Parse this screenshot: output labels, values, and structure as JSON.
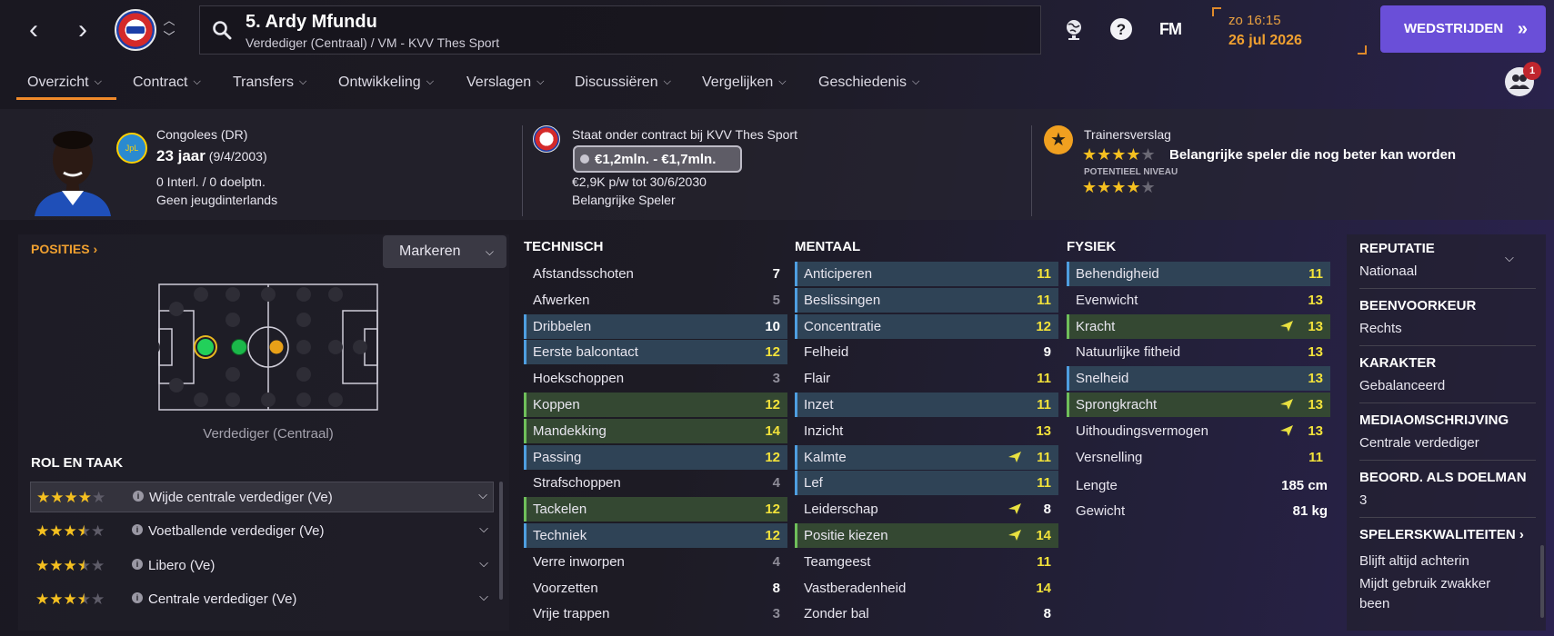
{
  "header": {
    "player_name": "5. Ardy Mfundu",
    "player_subtitle": "Verdediger (Centraal) / VM - KVV Thes Sport",
    "fm_logo": "FM",
    "date_time": "zo 16:15",
    "date": "26 jul 2026",
    "continue_button": "WEDSTRIJDEN",
    "icons": [
      "back-icon",
      "forward-icon",
      "club-logo",
      "up-down-icon",
      "search-icon",
      "globe-icon",
      "help-icon",
      "fm-logo"
    ]
  },
  "tabs": [
    "Overzicht",
    "Contract",
    "Transfers",
    "Ontwikkeling",
    "Verslagen",
    "Discussiëren",
    "Vergelijken",
    "Geschiedenis"
  ],
  "social_badge": "1",
  "profile": {
    "nationality": "Congolees (DR)",
    "flag_text": "JpL",
    "age": "23 jaar",
    "dob": "(9/4/2003)",
    "caps": "0 Interl. / 0 doelptn.",
    "youth": "Geen jeugdinterlands"
  },
  "contract": {
    "status": "Staat onder contract bij KVV Thes Sport",
    "value": "€1,2mln. - €1,7mln.",
    "wage": "€2,9K p/w tot 30/6/2030",
    "role": "Belangrijke Speler"
  },
  "report": {
    "title": "Trainersverslag",
    "ability_stars": 4,
    "ability_text": "Belangrijke speler die nog beter kan worden",
    "potential_label": "POTENTIEEL NIVEAU",
    "potential_stars": 4
  },
  "positions": {
    "title": "POSITIES",
    "mark_button": "Markeren",
    "position_label": "Verdediger (Centraal)",
    "role_title": "ROL EN TAAK",
    "roles": [
      {
        "stars": 4,
        "label": "Wijde centrale verdediger (Ve)"
      },
      {
        "stars": 3.5,
        "label": "Voetballende verdediger (Ve)"
      },
      {
        "stars": 3.5,
        "label": "Libero (Ve)"
      },
      {
        "stars": 3.5,
        "label": "Centrale verdediger (Ve)"
      }
    ]
  },
  "attributes": {
    "technical_title": "TECHNISCH",
    "mental_title": "MENTAAL",
    "physical_title": "FYSIEK",
    "technical": [
      {
        "name": "Afstandsschoten",
        "value": "7",
        "hl": "",
        "tone": "white"
      },
      {
        "name": "Afwerken",
        "value": "5",
        "hl": "",
        "tone": "grey"
      },
      {
        "name": "Dribbelen",
        "value": "10",
        "hl": "blue",
        "tone": "white"
      },
      {
        "name": "Eerste balcontact",
        "value": "12",
        "hl": "blue",
        "tone": "yellow"
      },
      {
        "name": "Hoekschoppen",
        "value": "3",
        "hl": "",
        "tone": "grey"
      },
      {
        "name": "Koppen",
        "value": "12",
        "hl": "green",
        "tone": "yellow"
      },
      {
        "name": "Mandekking",
        "value": "14",
        "hl": "green",
        "tone": "yellow"
      },
      {
        "name": "Passing",
        "value": "12",
        "hl": "blue",
        "tone": "yellow"
      },
      {
        "name": "Strafschoppen",
        "value": "4",
        "hl": "",
        "tone": "grey"
      },
      {
        "name": "Tackelen",
        "value": "12",
        "hl": "green",
        "tone": "yellow"
      },
      {
        "name": "Techniek",
        "value": "12",
        "hl": "blue",
        "tone": "yellow"
      },
      {
        "name": "Verre inworpen",
        "value": "4",
        "hl": "",
        "tone": "grey"
      },
      {
        "name": "Voorzetten",
        "value": "8",
        "hl": "",
        "tone": "white"
      },
      {
        "name": "Vrije trappen",
        "value": "3",
        "hl": "",
        "tone": "grey"
      }
    ],
    "mental": [
      {
        "name": "Anticiperen",
        "value": "11",
        "hl": "blue",
        "tone": "yellow"
      },
      {
        "name": "Beslissingen",
        "value": "11",
        "hl": "blue",
        "tone": "yellow"
      },
      {
        "name": "Concentratie",
        "value": "12",
        "hl": "blue",
        "tone": "yellow"
      },
      {
        "name": "Felheid",
        "value": "9",
        "hl": "",
        "tone": "white"
      },
      {
        "name": "Flair",
        "value": "11",
        "hl": "",
        "tone": "yellow"
      },
      {
        "name": "Inzet",
        "value": "11",
        "hl": "blue",
        "tone": "yellow"
      },
      {
        "name": "Inzicht",
        "value": "13",
        "hl": "",
        "tone": "yellow"
      },
      {
        "name": "Kalmte",
        "value": "11",
        "hl": "blue",
        "tone": "yellow",
        "trend": true
      },
      {
        "name": "Lef",
        "value": "11",
        "hl": "blue",
        "tone": "yellow"
      },
      {
        "name": "Leiderschap",
        "value": "8",
        "hl": "",
        "tone": "white",
        "trend": true
      },
      {
        "name": "Positie kiezen",
        "value": "14",
        "hl": "green",
        "tone": "yellow",
        "trend": true
      },
      {
        "name": "Teamgeest",
        "value": "11",
        "hl": "",
        "tone": "yellow"
      },
      {
        "name": "Vastberadenheid",
        "value": "14",
        "hl": "",
        "tone": "yellow"
      },
      {
        "name": "Zonder bal",
        "value": "8",
        "hl": "",
        "tone": "white"
      }
    ],
    "physical": [
      {
        "name": "Behendigheid",
        "value": "11",
        "hl": "blue",
        "tone": "yellow"
      },
      {
        "name": "Evenwicht",
        "value": "13",
        "hl": "",
        "tone": "yellow"
      },
      {
        "name": "Kracht",
        "value": "13",
        "hl": "green",
        "tone": "yellow",
        "trend": true
      },
      {
        "name": "Natuurlijke fitheid",
        "value": "13",
        "hl": "",
        "tone": "yellow"
      },
      {
        "name": "Snelheid",
        "value": "13",
        "hl": "blue",
        "tone": "yellow"
      },
      {
        "name": "Sprongkracht",
        "value": "13",
        "hl": "green",
        "tone": "yellow",
        "trend": true
      },
      {
        "name": "Uithoudingsvermogen",
        "value": "13",
        "hl": "",
        "tone": "yellow",
        "trend": true
      },
      {
        "name": "Versnelling",
        "value": "11",
        "hl": "",
        "tone": "yellow"
      }
    ],
    "height_label": "Lengte",
    "height_value": "185 cm",
    "weight_label": "Gewicht",
    "weight_value": "81 kg"
  },
  "info": {
    "reputation_label": "REPUTATIE",
    "reputation": "Nationaal",
    "foot_label": "BEENVOORKEUR",
    "foot": "Rechts",
    "personality_label": "KARAKTER",
    "personality": "Gebalanceerd",
    "media_label": "MEDIAOMSCHRIJVING",
    "media": "Centrale verdediger",
    "gk_label": "BEOORD. ALS DOELMAN",
    "gk": "3",
    "traits_label": "SPELERSKWALITEITEN",
    "traits": [
      "Blijft altijd achterin",
      "Mijdt gebruik zwakker",
      "been"
    ]
  },
  "colors": {
    "accent_orange": "#f08a2a",
    "button_purple": "#6a4fd8",
    "highlight_blue": "#2f4356",
    "highlight_green": "#344832",
    "value_yellow": "#f2e23a",
    "star_gold": "#f5c020"
  }
}
